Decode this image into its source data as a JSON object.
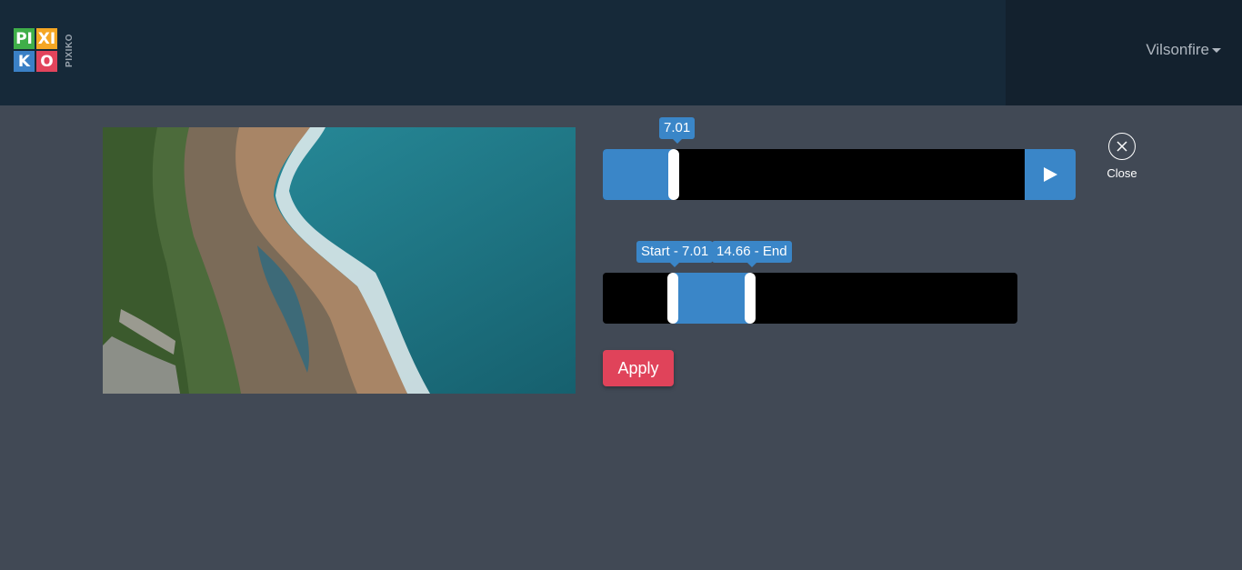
{
  "brand": {
    "tiles": [
      "PI",
      "XI",
      "K",
      "O"
    ],
    "vertical_text": "PIXIKO",
    "colors": {
      "green": "#3fae49",
      "orange": "#f5a623",
      "blue": "#3a80c6",
      "red": "#e2445c"
    }
  },
  "header": {
    "user_name": "Vilsonfire"
  },
  "player": {
    "current_time_label": "7.01",
    "progress_fraction": 0.15,
    "play_icon": "play-icon"
  },
  "trim": {
    "start_label": "Start - 7.01",
    "end_label": "14.66 - End",
    "start_fraction": 0.17,
    "end_fraction": 0.355
  },
  "actions": {
    "apply_label": "Apply",
    "close_label": "Close",
    "close_icon": "close-icon"
  },
  "colors": {
    "accent": "#3a86c8",
    "apply": "#e0435a",
    "background": "#414955",
    "topbar": "#162939"
  }
}
